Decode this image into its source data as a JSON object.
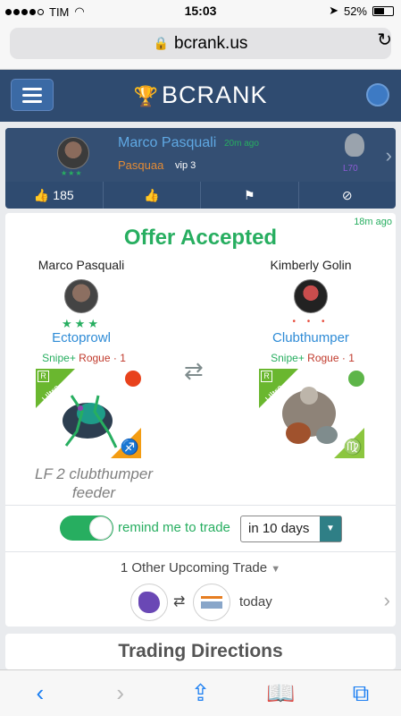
{
  "status_bar": {
    "carrier": "TIM",
    "time": "15:03",
    "battery": "52%"
  },
  "browser": {
    "url": "bcrank.us"
  },
  "app": {
    "brand": "BCRANK"
  },
  "post": {
    "name": "Marco Pasquali",
    "time": "20m ago",
    "username": "Pasquaa",
    "vip": "vip 3",
    "level": "L70",
    "likes": "185"
  },
  "offer": {
    "time": "18m ago",
    "title": "Offer Accepted",
    "left": {
      "trader": "Marco Pasquali",
      "monster": "Ectoprowl",
      "snipe": "Snipe+",
      "rogue": "Rogue · 1",
      "rarity_badge": "R",
      "rarity": "Ultra",
      "zodiac": "♐",
      "element_color": "#e8421c"
    },
    "right": {
      "trader": "Kimberly Golin",
      "monster": "Clubthumper",
      "snipe": "Snipe+",
      "rogue": "Rogue · 1",
      "rarity_badge": "R",
      "rarity": "Ultra",
      "zodiac": "♍",
      "element_color": "#5db548"
    },
    "note": "LF 2 clubthumper feeder",
    "remind_label": "remind me to trade",
    "remind_value": "in 10 days",
    "upcoming_label": "1 Other Upcoming Trade",
    "upcoming_when": "today"
  },
  "directions": {
    "title": "Trading Directions"
  }
}
